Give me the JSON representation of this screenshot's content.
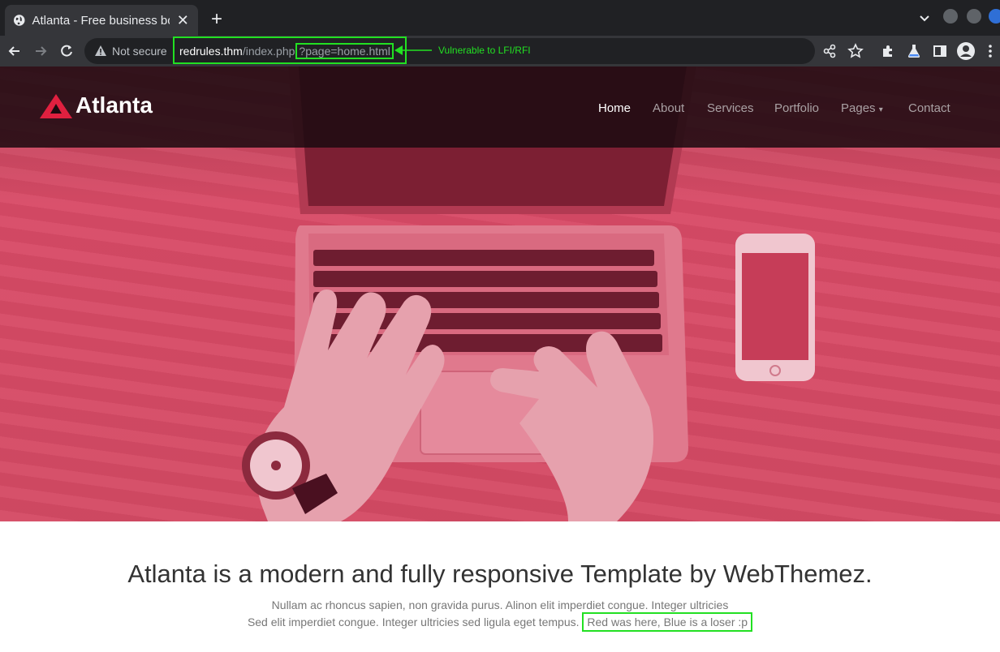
{
  "browser": {
    "tab_title": "Atlanta - Free business bo",
    "security_label": "Not secure",
    "url_host": "redrules.thm",
    "url_path": "/index.php",
    "url_query": "?page=home.html",
    "annotation": "Vulnerable to LFI/RFI"
  },
  "site": {
    "logo": "Atlanta",
    "nav": [
      "Home",
      "About",
      "Services",
      "Portfolio",
      "Pages",
      "Contact"
    ],
    "active_nav": "Home"
  },
  "content": {
    "heading": "Atlanta is a modern and fully responsive Template by WebThemez.",
    "line1": "Nullam ac rhoncus sapien, non gravida purus. Alinon elit imperdiet congue. Integer ultricies",
    "line2": "Sed elit imperdiet congue. Integer ultricies sed ligula eget tempus.",
    "highlight": "Red was here, Blue is a loser :p"
  },
  "colors": {
    "annotation": "#22e022",
    "hero_tint": "#d84a66",
    "logo_accent": "#e0203f"
  }
}
